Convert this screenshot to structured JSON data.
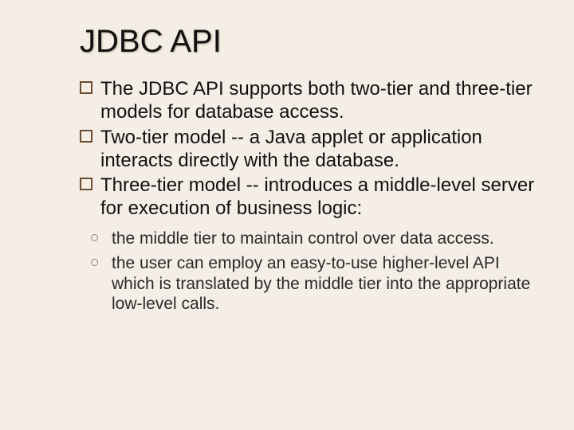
{
  "title": "JDBC API",
  "bullets": [
    "The JDBC API supports both two-tier and three-tier models for database access.",
    "Two-tier model -- a Java applet or application interacts directly with the database.",
    "Three-tier model -- introduces a middle-level server for execution of business logic:"
  ],
  "sub_bullets": [
    "the middle tier to maintain control over data access.",
    "the user can employ an easy-to-use higher-level API which is translated by the middle tier into the appropriate low-level calls."
  ]
}
